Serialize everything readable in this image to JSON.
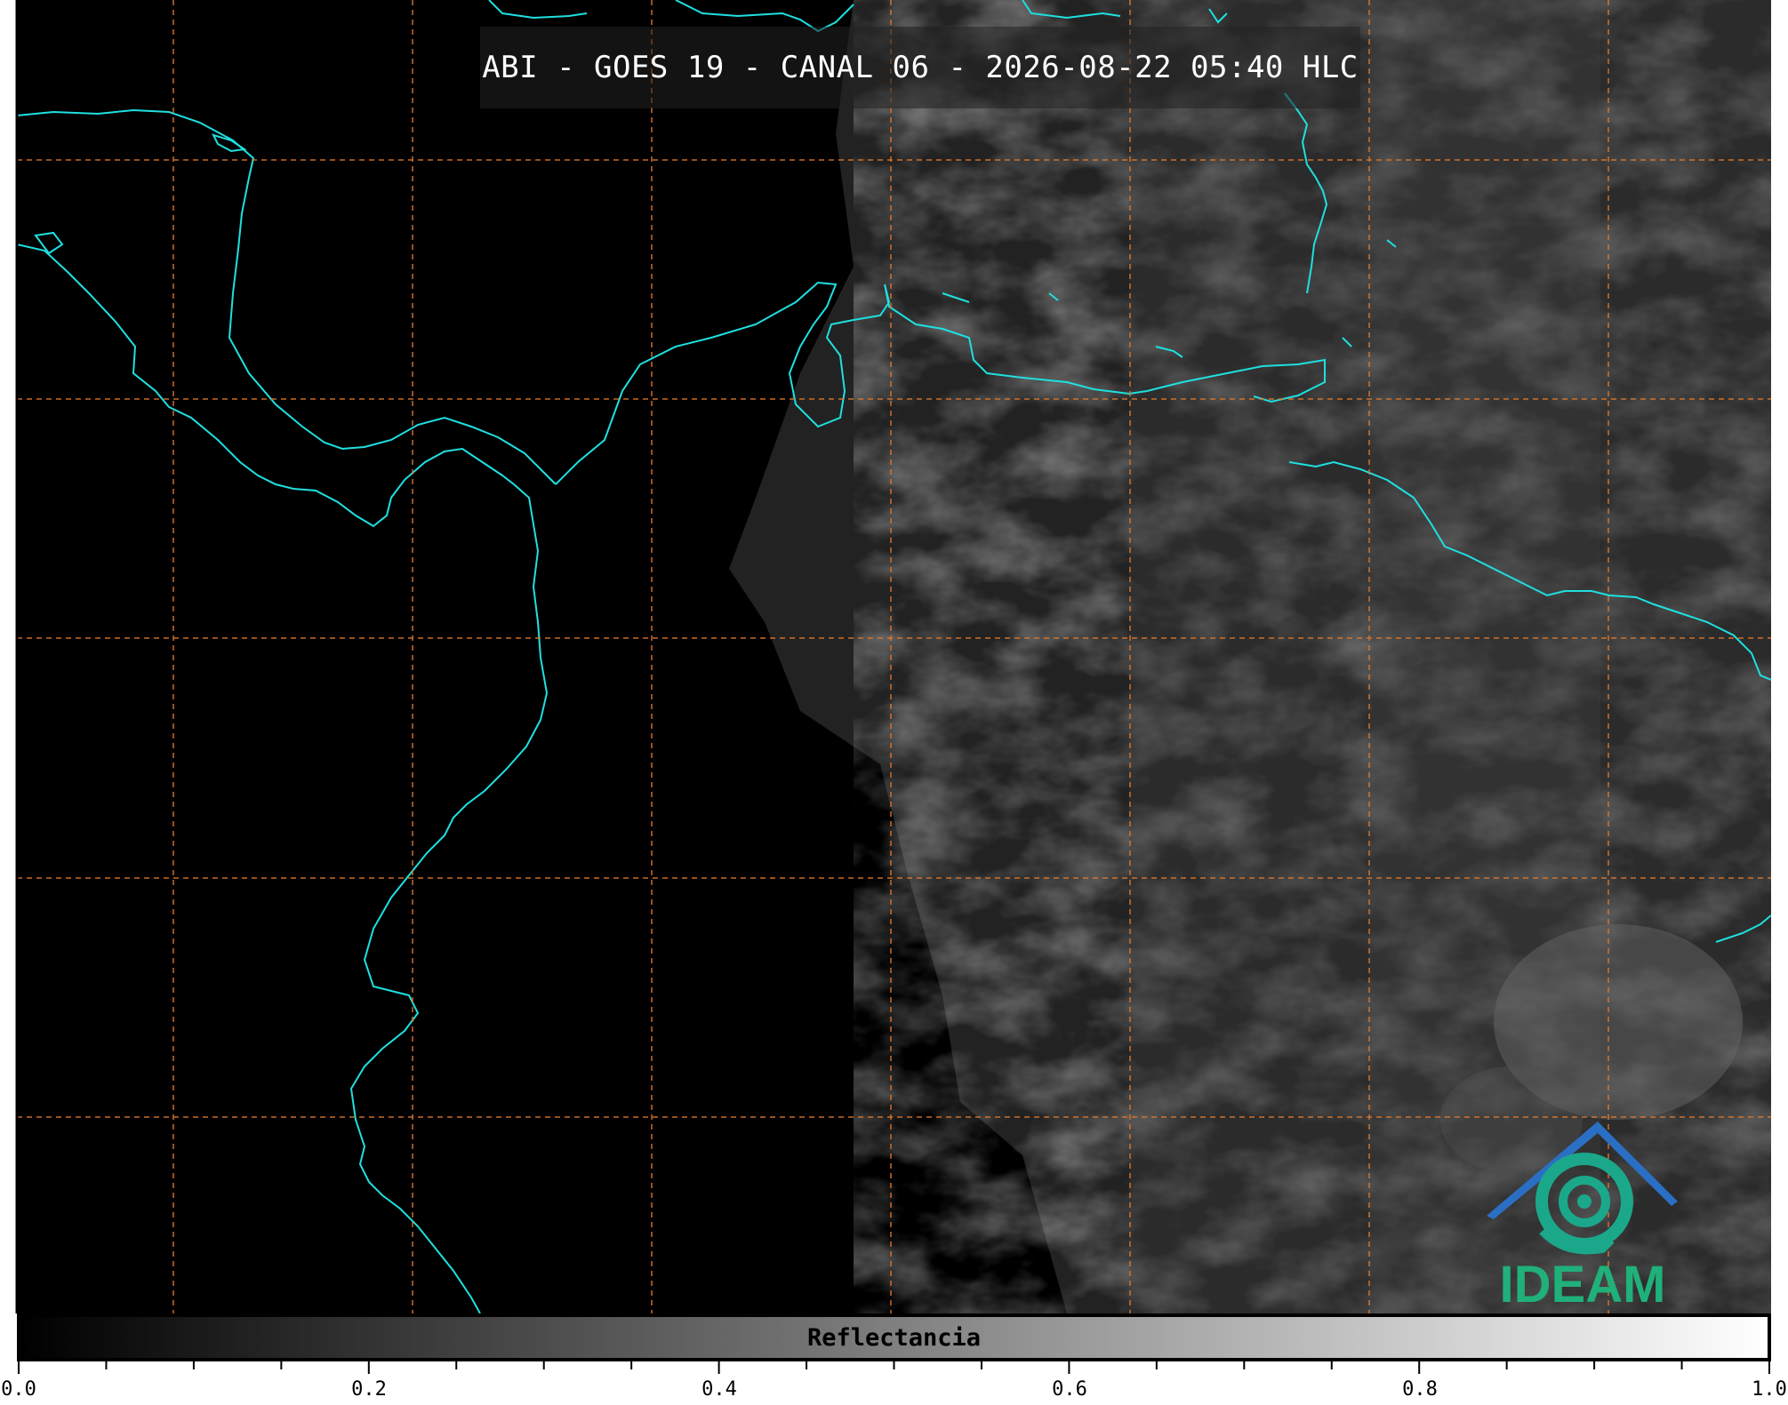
{
  "title": "ABI - GOES 19 - CANAL 06 - 2026-08-22 05:40 HLC",
  "colorbar": {
    "label": "Reflectancia",
    "min": 0.0,
    "max": 1.0,
    "ticks": [
      "0.0",
      "0.2",
      "0.4",
      "0.6",
      "0.8",
      "1.0"
    ],
    "gradient": [
      "#000000",
      "#ffffff"
    ]
  },
  "logo": {
    "text": "IDEAM",
    "colors": [
      "#2b6fc4",
      "#1ba88a",
      "#20b07a"
    ]
  },
  "colors": {
    "coastline": "#1fe0e0",
    "gridline": "#e0782a",
    "background": "#000000"
  }
}
